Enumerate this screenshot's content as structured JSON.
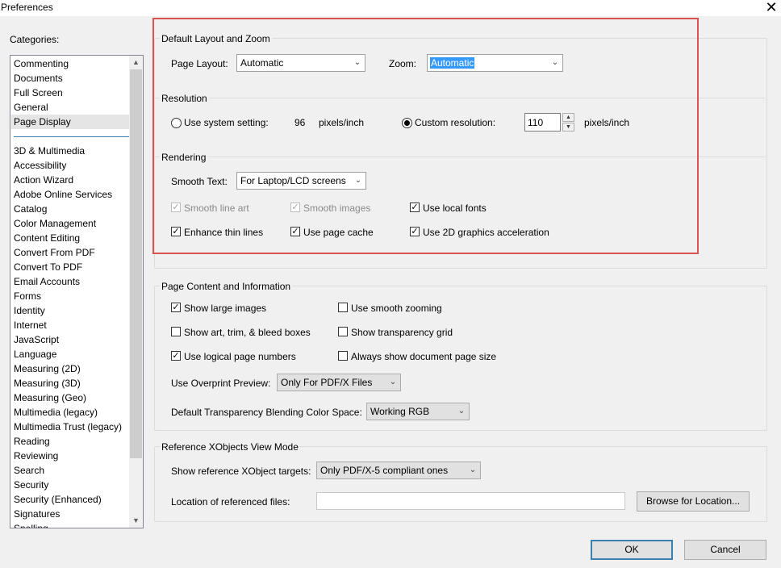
{
  "window": {
    "title": "Preferences",
    "close_glyph": "✕"
  },
  "categories": {
    "label": "Categories:",
    "top_items": [
      "Commenting",
      "Documents",
      "Full Screen",
      "General",
      "Page Display"
    ],
    "selected": "Page Display",
    "items": [
      "3D & Multimedia",
      "Accessibility",
      "Action Wizard",
      "Adobe Online Services",
      "Catalog",
      "Color Management",
      "Content Editing",
      "Convert From PDF",
      "Convert To PDF",
      "Email Accounts",
      "Forms",
      "Identity",
      "Internet",
      "JavaScript",
      "Language",
      "Measuring (2D)",
      "Measuring (3D)",
      "Measuring (Geo)",
      "Multimedia (legacy)",
      "Multimedia Trust (legacy)",
      "Reading",
      "Reviewing",
      "Search",
      "Security",
      "Security (Enhanced)",
      "Signatures",
      "Spelling"
    ]
  },
  "layout_zoom": {
    "legend": "Default Layout and Zoom",
    "page_layout_label": "Page Layout:",
    "page_layout_value": "Automatic",
    "zoom_label": "Zoom:",
    "zoom_value": "Automatic"
  },
  "resolution": {
    "legend": "Resolution",
    "system_label": "Use system setting:",
    "system_value": "96",
    "system_unit": "pixels/inch",
    "custom_label": "Custom resolution:",
    "custom_value": "110",
    "custom_unit": "pixels/inch",
    "selected": "custom"
  },
  "rendering": {
    "legend": "Rendering",
    "smooth_text_label": "Smooth Text:",
    "smooth_text_value": "For Laptop/LCD screens",
    "smooth_line_art": "Smooth line art",
    "smooth_images": "Smooth images",
    "use_local_fonts": "Use local fonts",
    "enhance_thin_lines": "Enhance thin lines",
    "use_page_cache": "Use page cache",
    "use_2d_accel": "Use 2D graphics acceleration"
  },
  "page_content": {
    "legend": "Page Content and Information",
    "show_large_images": "Show large images",
    "use_smooth_zooming": "Use smooth zooming",
    "show_art_boxes": "Show art, trim, & bleed boxes",
    "show_transparency_grid": "Show transparency grid",
    "use_logical_page_numbers": "Use logical page numbers",
    "always_show_page_size": "Always show document page size",
    "overprint_label": "Use Overprint Preview:",
    "overprint_value": "Only For PDF/X Files",
    "blending_label": "Default Transparency Blending Color Space:",
    "blending_value": "Working RGB"
  },
  "xobjects": {
    "legend": "Reference XObjects View Mode",
    "targets_label": "Show reference XObject targets:",
    "targets_value": "Only PDF/X-5 compliant ones",
    "location_label": "Location of referenced files:",
    "location_value": "",
    "browse_label": "Browse for Location..."
  },
  "buttons": {
    "ok": "OK",
    "cancel": "Cancel"
  },
  "colors": {
    "highlight": "#d9534f",
    "selection": "#3399ff",
    "accent": "#3c7fb1"
  }
}
